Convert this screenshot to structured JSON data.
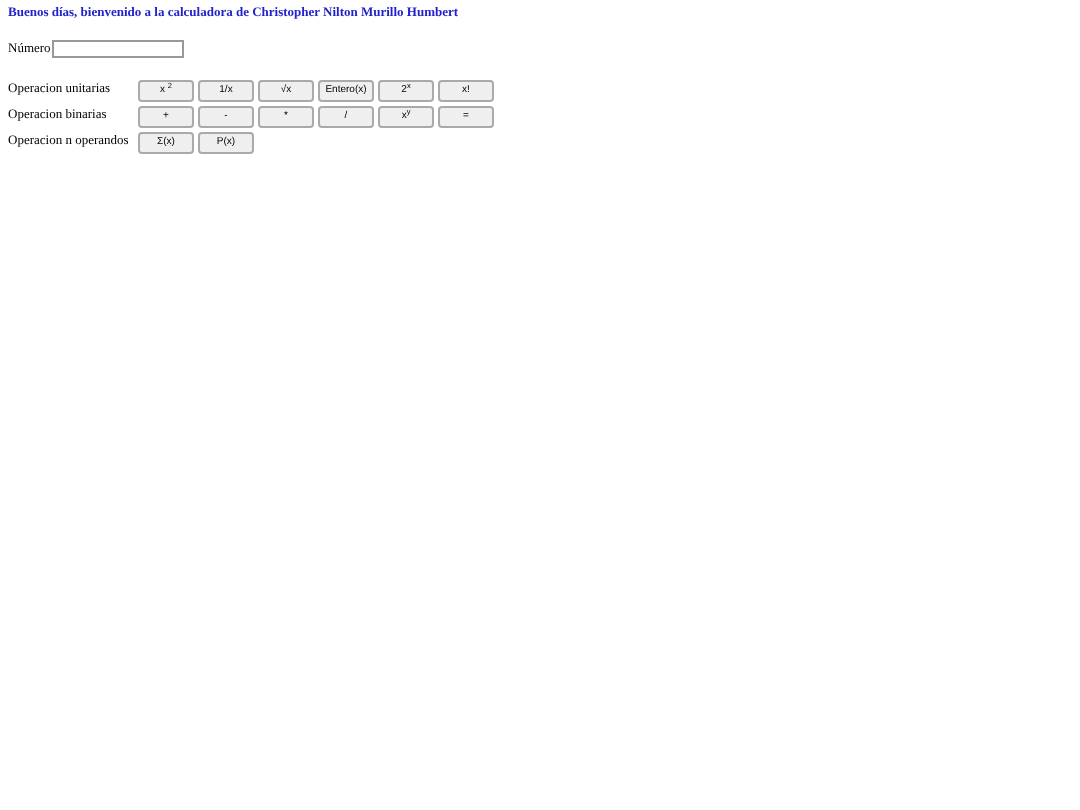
{
  "title": "Buenos días, bienvenido a la calculadora de Christopher Nilton Murillo Humbert",
  "number_field": {
    "label": "Número"
  },
  "rows": [
    {
      "label": "Operacion unitarias",
      "buttons": [
        "x $^{2}$",
        "1/x",
        "√x",
        "Entero(x)",
        "2$^{x}$",
        "x!"
      ]
    },
    {
      "label": "Operacion binarias",
      "buttons": [
        "+",
        "-",
        "*",
        "/",
        "x$^{y}$",
        "="
      ]
    },
    {
      "label": "Operacion n operandos",
      "buttons": [
        "Σ(x)",
        "P(x)"
      ]
    }
  ]
}
